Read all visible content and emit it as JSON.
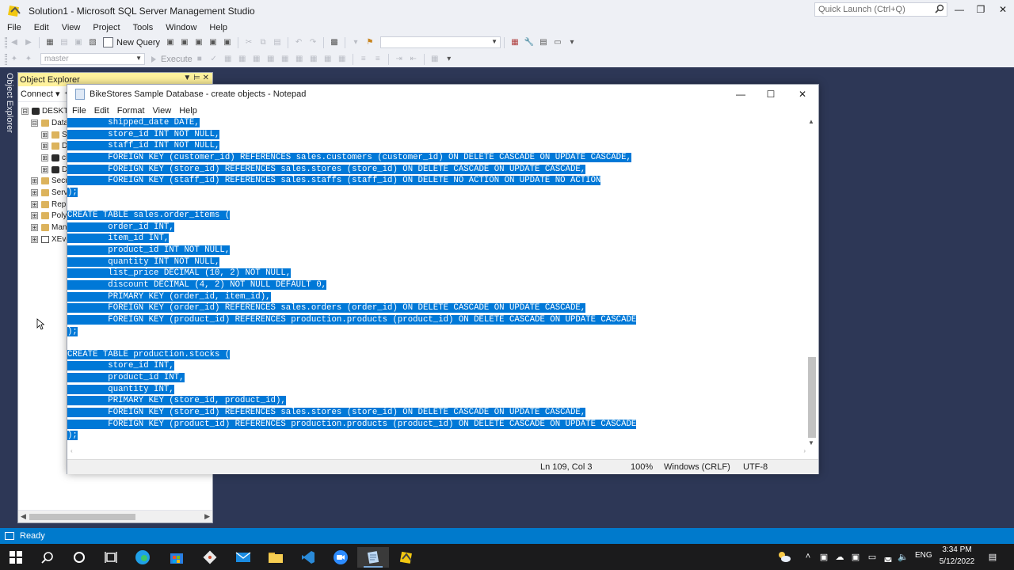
{
  "ssms": {
    "title": "Solution1 - Microsoft SQL Server Management Studio",
    "quick_launch_placeholder": "Quick Launch (Ctrl+Q)",
    "menu": [
      "File",
      "Edit",
      "View",
      "Project",
      "Tools",
      "Window",
      "Help"
    ],
    "toolbar": {
      "new_query_label": "New Query",
      "database_combo_value": "master",
      "execute_label": "Execute"
    },
    "status_text": "Ready",
    "vertical_tab_label": "Object Explorer"
  },
  "object_explorer": {
    "title": "Object Explorer",
    "connect_label": "Connect",
    "tree": [
      {
        "expander": "⊟",
        "icon": "server",
        "label": "DESKTO"
      },
      {
        "expander": "⊟",
        "icon": "folder",
        "label": "Data"
      },
      {
        "expander": "⊞",
        "icon": "folder",
        "label": "Sy"
      },
      {
        "expander": "⊞",
        "icon": "folder",
        "label": "D"
      },
      {
        "expander": "⊞",
        "icon": "database",
        "label": "cl"
      },
      {
        "expander": "⊞",
        "icon": "database",
        "label": "D"
      },
      {
        "expander": "⊞",
        "icon": "folder",
        "label": "Secu"
      },
      {
        "expander": "⊞",
        "icon": "folder",
        "label": "Serve"
      },
      {
        "expander": "⊞",
        "icon": "folder",
        "label": "Repl"
      },
      {
        "expander": "⊞",
        "icon": "folder",
        "label": "Poly"
      },
      {
        "expander": "⊞",
        "icon": "folder",
        "label": "Mana"
      },
      {
        "expander": "⊞",
        "icon": "xevent",
        "label": "XEve"
      }
    ]
  },
  "notepad": {
    "title": "BikeStores Sample Database - create objects - Notepad",
    "menu": [
      "File",
      "Edit",
      "Format",
      "View",
      "Help"
    ],
    "lines": [
      "        shipped_date DATE,",
      "        store_id INT NOT NULL,",
      "        staff_id INT NOT NULL,",
      "        FOREIGN KEY (customer_id) REFERENCES sales.customers (customer_id) ON DELETE CASCADE ON UPDATE CASCADE,",
      "        FOREIGN KEY (store_id) REFERENCES sales.stores (store_id) ON DELETE CASCADE ON UPDATE CASCADE,",
      "        FOREIGN KEY (staff_id) REFERENCES sales.staffs (staff_id) ON DELETE NO ACTION ON UPDATE NO ACTION",
      ");",
      "",
      "CREATE TABLE sales.order_items (",
      "        order_id INT,",
      "        item_id INT,",
      "        product_id INT NOT NULL,",
      "        quantity INT NOT NULL,",
      "        list_price DECIMAL (10, 2) NOT NULL,",
      "        discount DECIMAL (4, 2) NOT NULL DEFAULT 0,",
      "        PRIMARY KEY (order_id, item_id),",
      "        FOREIGN KEY (order_id) REFERENCES sales.orders (order_id) ON DELETE CASCADE ON UPDATE CASCADE,",
      "        FOREIGN KEY (product_id) REFERENCES production.products (product_id) ON DELETE CASCADE ON UPDATE CASCADE",
      ");",
      "",
      "CREATE TABLE production.stocks (",
      "        store_id INT,",
      "        product_id INT,",
      "        quantity INT,",
      "        PRIMARY KEY (store_id, product_id),",
      "        FOREIGN KEY (store_id) REFERENCES sales.stores (store_id) ON DELETE CASCADE ON UPDATE CASCADE,",
      "        FOREIGN KEY (product_id) REFERENCES production.products (product_id) ON DELETE CASCADE ON UPDATE CASCADE",
      ");"
    ],
    "status": {
      "position": "Ln 109, Col 3",
      "zoom": "100%",
      "line_ending": "Windows (CRLF)",
      "encoding": "UTF-8"
    },
    "selection_color": "#0078d7"
  },
  "taskbar": {
    "apps": [
      "start",
      "search",
      "cortana",
      "task-view",
      "edge",
      "store",
      "git",
      "mail",
      "file-explorer",
      "vscode",
      "zoom",
      "notepad",
      "ssms"
    ],
    "active_app": "notepad",
    "language": "ENG",
    "time": "3:34 PM",
    "date": "5/12/2022"
  },
  "colors": {
    "status_bar": "#007acc",
    "object_explorer_header": "#fff29d",
    "desktop_background": "#2d3756"
  }
}
